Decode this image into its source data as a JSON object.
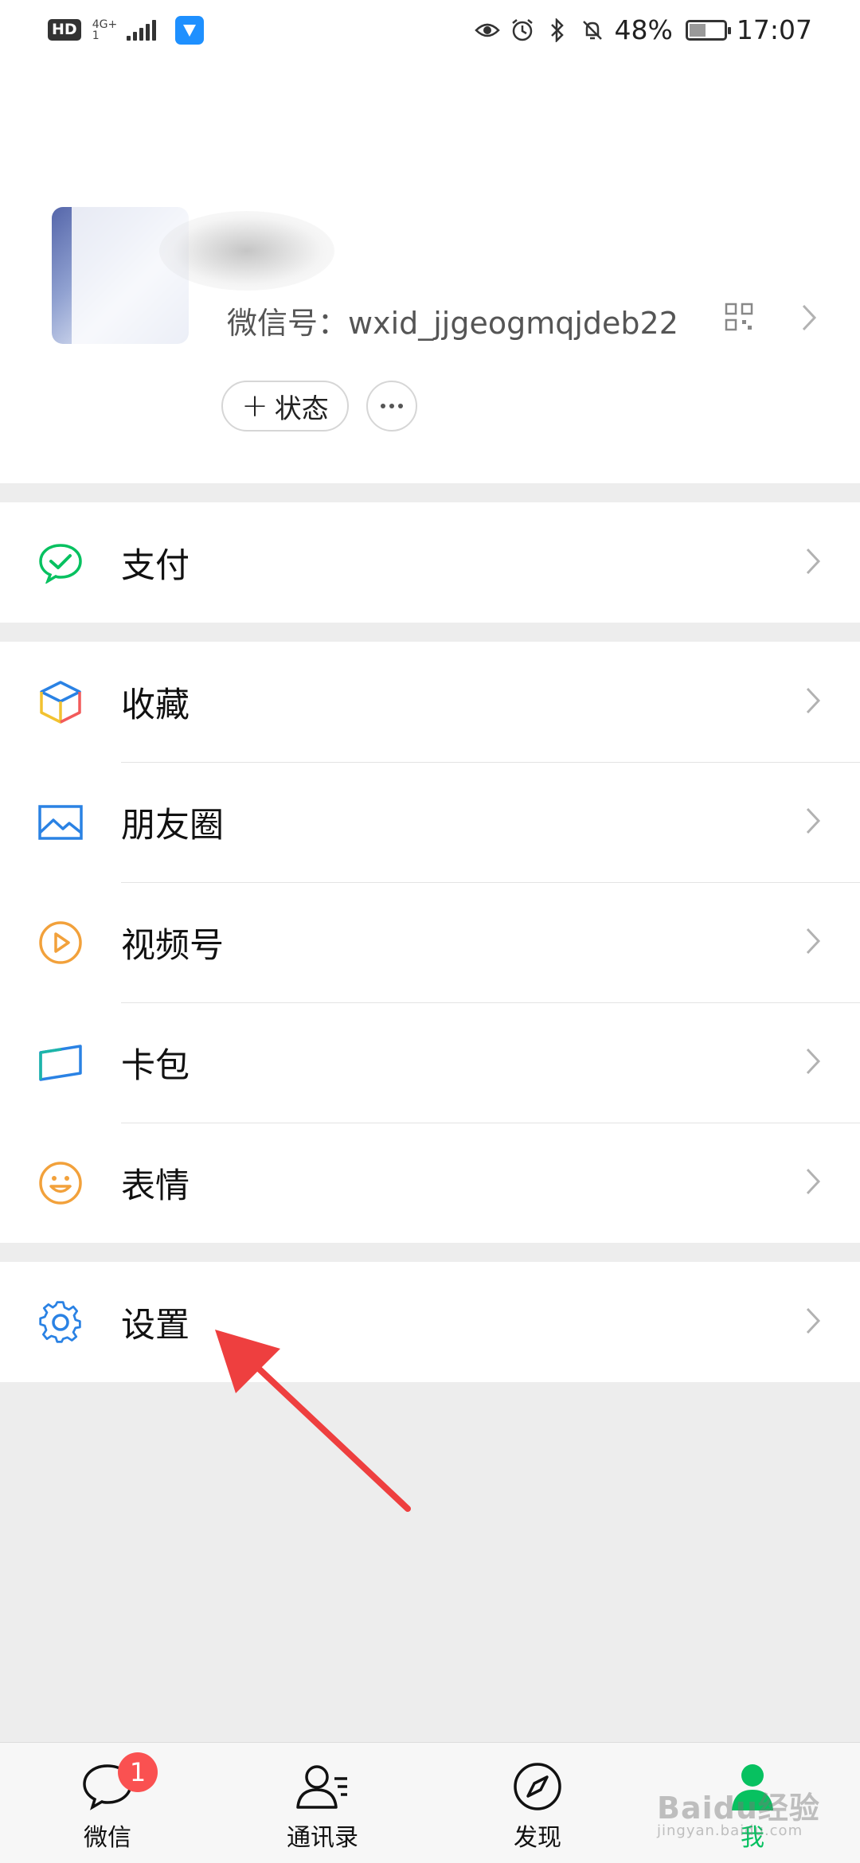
{
  "status_bar": {
    "hd": "HD",
    "network": "4G+",
    "network_sub": "1",
    "battery_percent": "48%",
    "battery_level": 0.48,
    "time": "17:07",
    "icons": [
      "eye-icon",
      "alarm-icon",
      "bluetooth-icon",
      "bell-off-icon"
    ]
  },
  "profile": {
    "wechat_id": "微信号：wxid_jjgeogmqjdeb22",
    "status_label": "状态"
  },
  "menu": {
    "pay": {
      "label": "支付",
      "icon": "pay-check-icon",
      "color": "#07c160"
    },
    "favorites": {
      "label": "收藏",
      "icon": "cube-icon"
    },
    "moments": {
      "label": "朋友圈",
      "icon": "photo-icon",
      "color": "#2a82e4"
    },
    "channels": {
      "label": "视频号",
      "icon": "play-circle-icon",
      "color": "#f2a13b"
    },
    "cards": {
      "label": "卡包",
      "icon": "card-icon",
      "color": "#2a82e4"
    },
    "stickers": {
      "label": "表情",
      "icon": "smile-icon",
      "color": "#f2a13b"
    },
    "settings": {
      "label": "设置",
      "icon": "gear-icon",
      "color": "#2a82e4"
    }
  },
  "tabbar": {
    "chats": {
      "label": "微信",
      "badge": "1"
    },
    "contacts": {
      "label": "通讯录"
    },
    "discover": {
      "label": "发现"
    },
    "me": {
      "label": "我"
    }
  },
  "watermark": {
    "text": "Baidu经验",
    "sub": "jingyan.baidu.com"
  }
}
